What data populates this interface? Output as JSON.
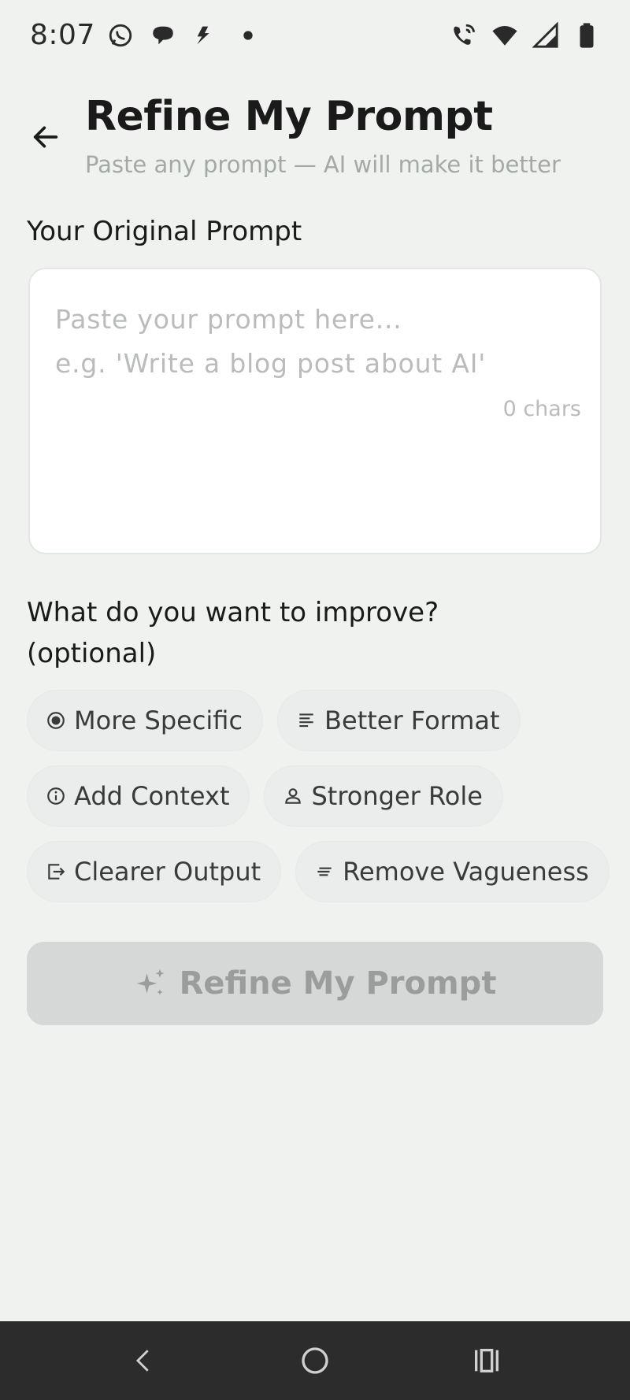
{
  "status_bar": {
    "time": "8:07",
    "left_icons": [
      "whatsapp-icon",
      "chat-bubble-icon",
      "bolt-icon",
      "dot-icon"
    ],
    "right_icons": [
      "wifi-call-icon",
      "wifi-icon",
      "signal-icon",
      "battery-icon"
    ]
  },
  "header": {
    "title": "Refine My Prompt",
    "subtitle": "Paste any prompt — AI will make it better",
    "back_icon": "arrow-left-icon"
  },
  "original_prompt": {
    "label": "Your Original Prompt",
    "value": "",
    "placeholder": "Paste your prompt here...\ne.g. 'Write a blog post about AI'",
    "char_count": "0 chars"
  },
  "improve": {
    "label": "What do you want to improve? (optional)",
    "options": [
      {
        "label": "More Specific",
        "icon": "target-icon"
      },
      {
        "label": "Better Format",
        "icon": "text-lines-icon"
      },
      {
        "label": "Add Context",
        "icon": "info-icon"
      },
      {
        "label": "Stronger Role",
        "icon": "person-icon"
      },
      {
        "label": "Clearer Output",
        "icon": "output-icon"
      },
      {
        "label": "Remove Vagueness",
        "icon": "short-text-icon"
      }
    ]
  },
  "submit": {
    "label": "Refine My Prompt",
    "icon": "sparkle-icon",
    "enabled": false
  },
  "nav_bar": {
    "buttons": [
      "back-chevron-icon",
      "home-circle-icon",
      "recents-icon"
    ]
  },
  "colors": {
    "background": "#eff2ef",
    "card": "#ffffff",
    "chip": "#eaedeb",
    "button_disabled": "#d6d8d7",
    "nav_bar": "#2c2c2c"
  }
}
